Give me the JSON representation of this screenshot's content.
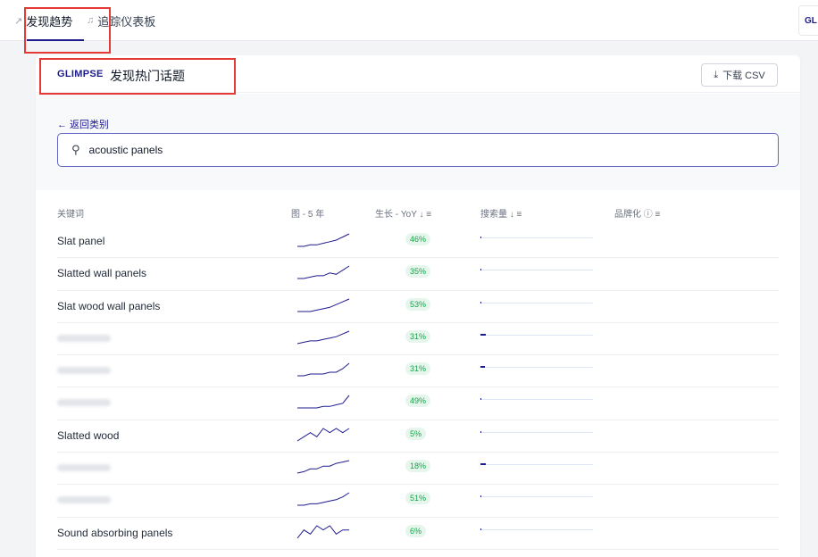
{
  "topnav": {
    "tabs": [
      {
        "label": "发现趋势",
        "icon": "trending-up-icon",
        "active": true
      },
      {
        "label": "追踪仪表板",
        "icon": "bell-icon",
        "active": false
      }
    ],
    "right_badge": "GL"
  },
  "card": {
    "logo": "GLIMPSE",
    "title": "发现热门话题",
    "download_label": "下载 CSV"
  },
  "search": {
    "back_label": "← 返回类别",
    "value": "acoustic panels"
  },
  "table": {
    "headers": {
      "keyword": "关键词",
      "chart": "图 - 5 年",
      "growth": "生长 - YoY ↓ ≡",
      "volume": "搜索量 ↓ ≡",
      "brand": "品牌化 ⓘ ≡"
    },
    "rows": [
      {
        "keyword": "Slat panel",
        "blurred": false,
        "growth": "46%",
        "volume_level": 0.01,
        "trend": [
          2,
          2,
          3,
          3,
          4,
          5,
          6,
          8,
          10
        ]
      },
      {
        "keyword": "Slatted wall panels",
        "blurred": false,
        "growth": "35%",
        "volume_level": 0.0,
        "trend": [
          1,
          1,
          2,
          3,
          3,
          5,
          4,
          7,
          10
        ]
      },
      {
        "keyword": "Slat wood wall panels",
        "blurred": false,
        "growth": "53%",
        "volume_level": 0.0,
        "trend": [
          1,
          1,
          1,
          2,
          3,
          4,
          6,
          8,
          10
        ]
      },
      {
        "keyword": "",
        "blurred": true,
        "growth": "31%",
        "volume_level": 0.05,
        "trend": [
          1,
          2,
          3,
          3,
          4,
          5,
          6,
          8,
          10
        ]
      },
      {
        "keyword": "",
        "blurred": true,
        "growth": "31%",
        "volume_level": 0.04,
        "trend": [
          3,
          3,
          4,
          4,
          4,
          5,
          5,
          7,
          10
        ]
      },
      {
        "keyword": "",
        "blurred": true,
        "growth": "49%",
        "volume_level": 0.01,
        "trend": [
          2,
          2,
          2,
          2,
          3,
          3,
          4,
          5,
          10
        ]
      },
      {
        "keyword": "Slatted wood",
        "blurred": false,
        "growth": "5%",
        "volume_level": 0.01,
        "trend": [
          2,
          3,
          4,
          3,
          5,
          4,
          5,
          4,
          5
        ]
      },
      {
        "keyword": "",
        "blurred": true,
        "growth": "18%",
        "volume_level": 0.05,
        "trend": [
          1,
          2,
          4,
          4,
          6,
          6,
          8,
          9,
          10
        ]
      },
      {
        "keyword": "",
        "blurred": true,
        "growth": "51%",
        "volume_level": 0.01,
        "trend": [
          1,
          1,
          2,
          2,
          3,
          4,
          5,
          7,
          10
        ]
      },
      {
        "keyword": "Sound absorbing panels",
        "blurred": false,
        "growth": "6%",
        "volume_level": 0.01,
        "trend": [
          2,
          4,
          3,
          5,
          4,
          5,
          3,
          4,
          4
        ]
      }
    ]
  },
  "colors": {
    "accent": "#1e1b8f",
    "growth_text": "#16a34a",
    "growth_bg": "#e6f6ec",
    "highlight": "#e53935"
  }
}
